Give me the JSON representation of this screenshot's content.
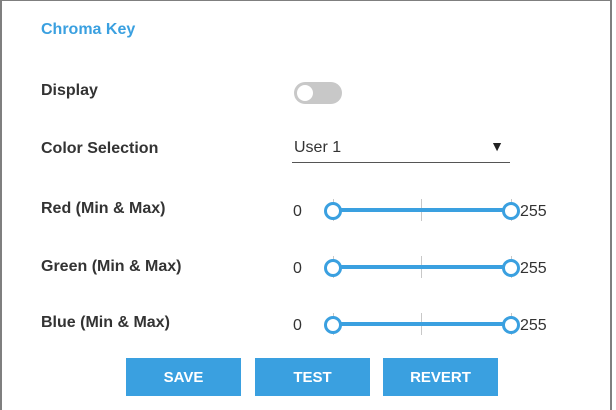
{
  "section_title": "Chroma Key",
  "display": {
    "label": "Display",
    "enabled": false
  },
  "color_selection": {
    "label": "Color Selection",
    "value": "User 1",
    "arrow": "▼"
  },
  "sliders": [
    {
      "label": "Red (Min & Max)",
      "min_label": "0",
      "max_label": "255",
      "min_value": 0,
      "max_value": 255
    },
    {
      "label": "Green (Min & Max)",
      "min_label": "0",
      "max_label": "255",
      "min_value": 0,
      "max_value": 255
    },
    {
      "label": "Blue (Min & Max)",
      "min_label": "0",
      "max_label": "255",
      "min_value": 0,
      "max_value": 255
    }
  ],
  "buttons": {
    "save": "SAVE",
    "test": "TEST",
    "revert": "REVERT"
  },
  "colors": {
    "accent": "#3aa0e0",
    "toggle_off": "#c8c8c8",
    "text": "#333333"
  }
}
